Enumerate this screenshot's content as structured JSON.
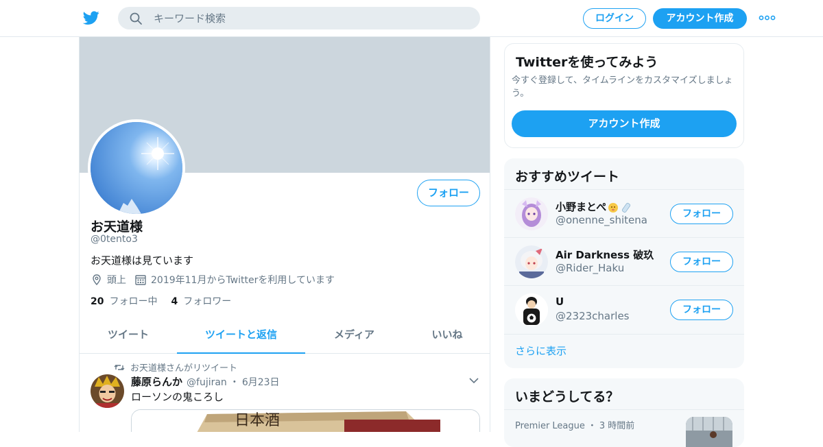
{
  "header": {
    "logo_icon": "twitter-bird-icon",
    "search": {
      "placeholder": "キーワード検索",
      "icon": "search-icon"
    },
    "login_label": "ログイン",
    "signup_label": "アカウント作成",
    "more_icon": "more-dots-icon"
  },
  "colors": {
    "accent": "#1da1f2",
    "secondary_text": "#657786",
    "banner": "#ccd6dd",
    "panel_bg": "#f5f8fa",
    "border": "#e1e8ed"
  },
  "profile": {
    "name": "お天道様",
    "handle": "@0tento3",
    "bio": "お天道様は見ています",
    "location": "頭上",
    "joined": "2019年11月からTwitterを利用しています",
    "follow_label": "フォロー",
    "following_count": "20",
    "following_label": "フォロー中",
    "followers_count": "4",
    "followers_label": "フォロワー"
  },
  "tabs": [
    {
      "label": "ツイート",
      "active": false
    },
    {
      "label": "ツイートと返信",
      "active": true
    },
    {
      "label": "メディア",
      "active": false
    },
    {
      "label": "いいね",
      "active": false
    }
  ],
  "tweet": {
    "retweet_note": "お天道様さんがリツイート",
    "author_name": "藤原らんか",
    "author_handle": "@fujiran",
    "date": "6月23日",
    "text": "ローソンの鬼ころし",
    "media_text": "日本酒"
  },
  "signup_card": {
    "title": "Twitterを使ってみよう",
    "description": "今すぐ登録して、タイムラインをカスタマイズしましょう。",
    "button_label": "アカウント作成"
  },
  "recommendations": {
    "title": "おすすめツイート",
    "items": [
      {
        "name": "小野まとぺ",
        "handle": "@onenne_shitena",
        "follow_label": "フォロー"
      },
      {
        "name": "Air Darkness 破玖",
        "handle": "@Rider_Haku",
        "follow_label": "フォロー"
      },
      {
        "name": "U",
        "handle": "@2323charles",
        "follow_label": "フォロー"
      }
    ],
    "more_label": "さらに表示"
  },
  "trends": {
    "title": "いまどうしてる？",
    "items": [
      {
        "source": "Premier League",
        "time": "3 時間前"
      }
    ]
  }
}
